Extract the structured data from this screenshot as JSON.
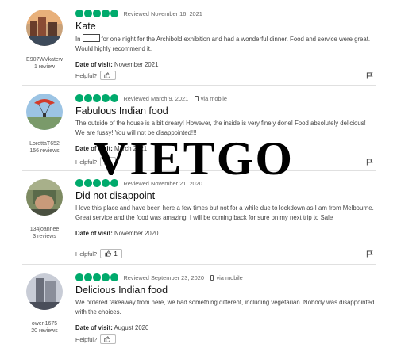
{
  "helpful_label": "Helpful?",
  "date_of_visit_label": "Date of visit:",
  "via_mobile_label": "via mobile",
  "watermark": "VIETGO",
  "colors": {
    "rating_bubble": "#00aa6c",
    "divider": "#e0e0e0"
  },
  "reviews": [
    {
      "username": "E907WVkatew",
      "user_count": "1 review",
      "rating": 5,
      "reviewed_date": "Reviewed November 16, 2021",
      "via_mobile": false,
      "title": "Kate",
      "text_before_censor": "In",
      "text_after_censor": "for one night for the Archibold exhibition and had a wonderful dinner. Food and service were great. Would highly recommend it.",
      "date_of_visit": "November 2021",
      "helpful_count": ""
    },
    {
      "username": "LorettaT652",
      "user_count": "156 reviews",
      "rating": 5,
      "reviewed_date": "Reviewed March 9, 2021",
      "via_mobile": true,
      "title": "Fabulous Indian food",
      "text": "The outside of the house is a bit dreary! However, the inside is very finely done! Food absolutely delicious! We are fussy! You will not be disappointed!!!",
      "date_of_visit": "March 2021",
      "helpful_count": ""
    },
    {
      "username": "134joannee",
      "user_count": "3 reviews",
      "rating": 5,
      "reviewed_date": "Reviewed November 21, 2020",
      "via_mobile": false,
      "title": "Did not disappoint",
      "text": "I love this place and have been here a few times but not for a while due to lockdown as I am from Melbourne. Great service and the food was amazing. I will be coming back for sure on my next trip to Sale",
      "date_of_visit": "November 2020",
      "helpful_count": "1"
    },
    {
      "username": "owen1675",
      "user_count": "20 reviews",
      "rating": 5,
      "reviewed_date": "Reviewed September 23, 2020",
      "via_mobile": true,
      "title": "Delicious Indian food",
      "text": "We ordered takeaway from here, we had something different, including vegetarian. Nobody was disappointed with the choices.",
      "date_of_visit": "August 2020",
      "helpful_count": ""
    }
  ]
}
